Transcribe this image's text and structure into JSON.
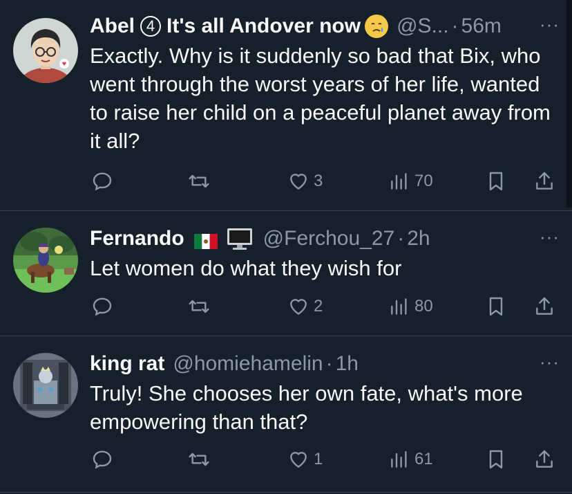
{
  "tweets": [
    {
      "name_part1": "Abel",
      "name_badge": "4",
      "name_part2": "It's all Andover now",
      "handle": "@S...",
      "separator": "·",
      "time": "56m",
      "more": "···",
      "text": "Exactly. Why is it suddenly so bad that Bix, who went through the worst years of her life, wanted to raise her child on a peaceful planet away from it all?",
      "replies": "",
      "retweets": "",
      "likes": "3",
      "views": "70"
    },
    {
      "name": "Fernando",
      "handle": "@Ferchou_27",
      "separator": "·",
      "time": "2h",
      "more": "···",
      "text": "Let women do what they wish for",
      "replies": "",
      "retweets": "",
      "likes": "2",
      "views": "80"
    },
    {
      "name": "king rat",
      "handle": "@homiehamelin",
      "separator": "·",
      "time": "1h",
      "more": "···",
      "text": "Truly! She chooses her own fate, what's more empowering than that?",
      "replies": "",
      "retweets": "",
      "likes": "1",
      "views": "61"
    }
  ],
  "icons": {
    "reply": "reply-icon",
    "retweet": "retweet-icon",
    "like": "heart-icon",
    "views": "views-icon",
    "bookmark": "bookmark-icon",
    "share": "share-icon"
  },
  "colors": {
    "background": "#15202b",
    "text": "#f7f9f9",
    "secondary": "#8b98a5",
    "divider": "#38444d"
  }
}
